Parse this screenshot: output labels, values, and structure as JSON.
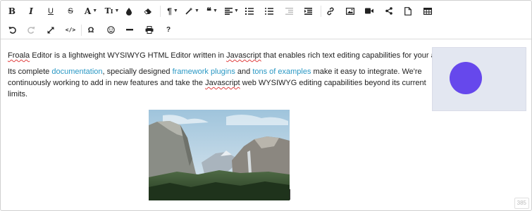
{
  "toolbar": {
    "row1": [
      {
        "name": "bold-button",
        "glyph": "B"
      },
      {
        "name": "italic-button",
        "glyph": "I"
      },
      {
        "name": "underline-button",
        "glyph": "U"
      },
      {
        "name": "strikethrough-button",
        "glyph": "S"
      },
      {
        "name": "font-family-button",
        "glyph": "A"
      },
      {
        "name": "font-size-button",
        "glyph": "TI"
      },
      {
        "name": "text-color-button",
        "icon": "drop-icon"
      },
      {
        "name": "clear-formatting-button",
        "icon": "eraser-icon"
      },
      {
        "name": "paragraph-format-button",
        "glyph": "¶"
      },
      {
        "name": "inline-style-button",
        "icon": "magic-wand-icon"
      },
      {
        "name": "quote-button",
        "glyph": "❝"
      },
      {
        "name": "align-button",
        "icon": "align-left-icon"
      },
      {
        "name": "ordered-list-button",
        "icon": "ordered-list-icon"
      },
      {
        "name": "unordered-list-button",
        "icon": "unordered-list-icon"
      },
      {
        "name": "outdent-button",
        "icon": "outdent-icon"
      },
      {
        "name": "indent-button",
        "icon": "indent-icon"
      },
      {
        "name": "insert-link-button",
        "icon": "link-icon"
      },
      {
        "name": "insert-image-button",
        "icon": "image-icon"
      },
      {
        "name": "insert-video-button",
        "icon": "video-icon"
      },
      {
        "name": "embed-button",
        "icon": "share-icon"
      },
      {
        "name": "insert-file-button",
        "icon": "file-icon"
      },
      {
        "name": "insert-table-button",
        "icon": "table-icon"
      }
    ],
    "row2": [
      {
        "name": "undo-button",
        "icon": "undo-icon"
      },
      {
        "name": "redo-button",
        "icon": "redo-icon"
      },
      {
        "name": "fullscreen-button",
        "icon": "expand-icon"
      },
      {
        "name": "code-view-button",
        "glyph": "</>"
      },
      {
        "name": "special-characters-button",
        "glyph": "Ω"
      },
      {
        "name": "emoticons-button",
        "icon": "smiley-icon"
      },
      {
        "name": "horizontal-line-button",
        "icon": "minus-icon"
      },
      {
        "name": "print-button",
        "icon": "printer-icon"
      },
      {
        "name": "help-button",
        "glyph": "?"
      }
    ]
  },
  "content": {
    "paragraph1": {
      "word1": "Froala",
      "text1": " Editor is a lightweight WYSIWYG HTML Editor written in ",
      "word2": "Javascript",
      "text2": " that enables rich text editing capabilities for your applications."
    },
    "paragraph2": {
      "text1": "Its complete ",
      "link1": "documentation",
      "text2": ", specially designed ",
      "link2": "framework plugins",
      "text3": " and ",
      "link3": "tons of examples",
      "text4": " make it easy to integrate. We're continuously working to add in new features and take the ",
      "word1": "Javascript",
      "text5": " web WYSIWYG editing capabilities beyond its current limits."
    }
  },
  "char_count": "385",
  "colors": {
    "link": "#2a98c4",
    "media_background": "#e3e7f1",
    "circle": "#6648ec",
    "spellcheck": "#e04040"
  }
}
